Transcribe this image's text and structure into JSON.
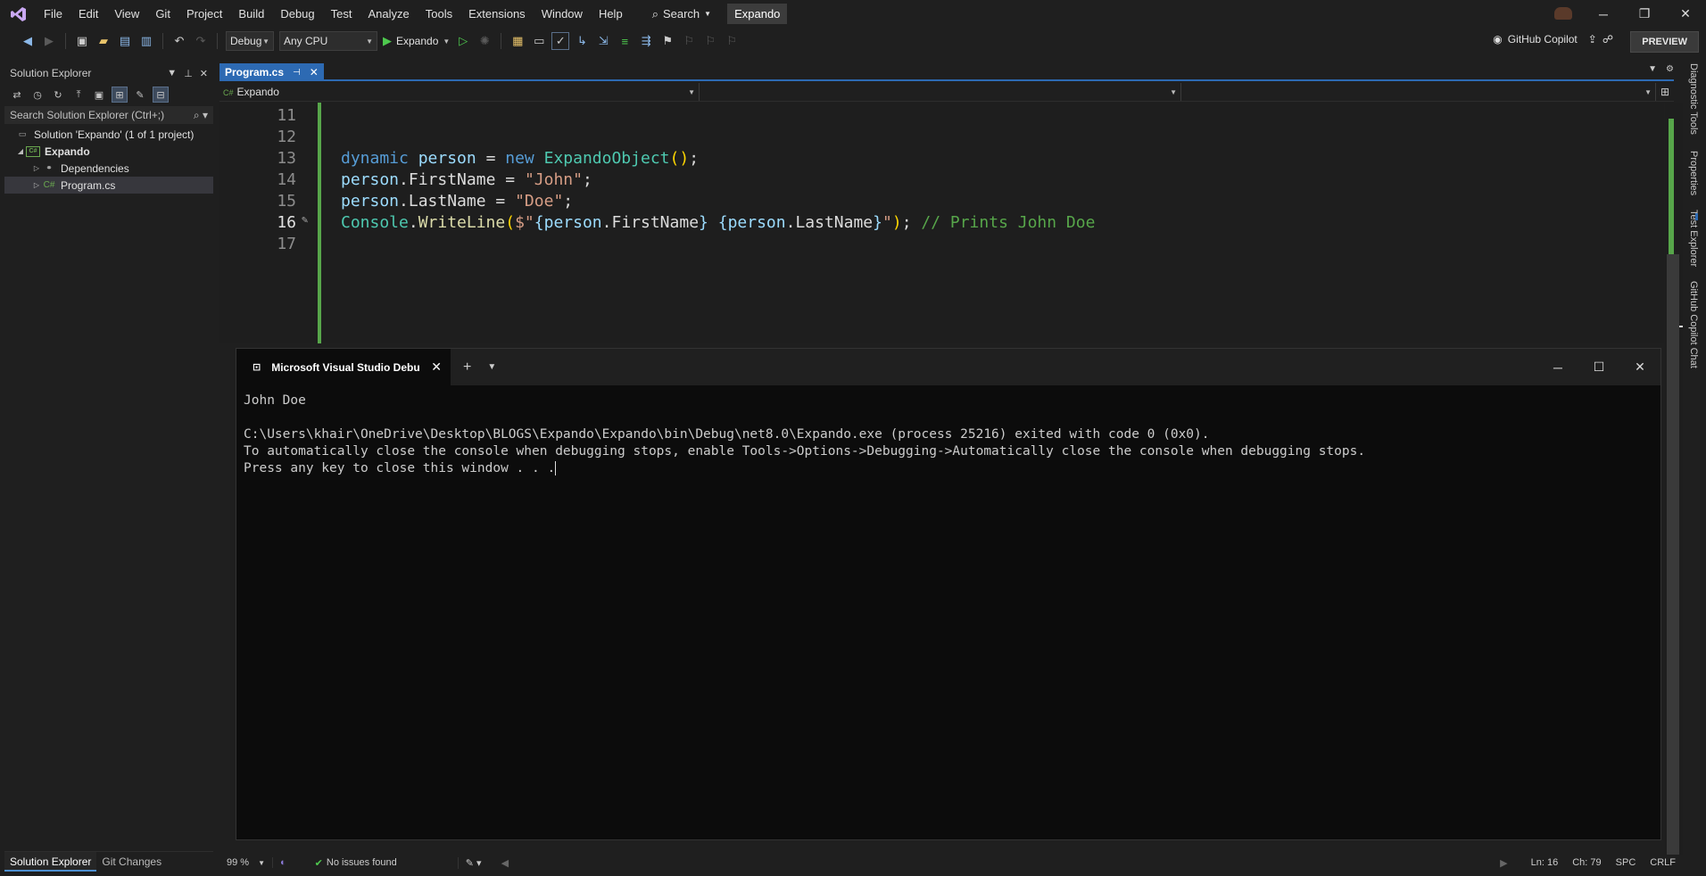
{
  "menubar": {
    "items": [
      "File",
      "Edit",
      "View",
      "Git",
      "Project",
      "Build",
      "Debug",
      "Test",
      "Analyze",
      "Tools",
      "Extensions",
      "Window",
      "Help"
    ],
    "search_label": "Search",
    "solution_badge": "Expando"
  },
  "toolbar": {
    "config": "Debug",
    "platform": "Any CPU",
    "run_target": "Expando",
    "copilot_label": "GitHub Copilot",
    "preview_label": "PREVIEW"
  },
  "solution_explorer": {
    "title": "Solution Explorer",
    "search_placeholder": "Search Solution Explorer (Ctrl+;)",
    "tree": {
      "solution": "Solution 'Expando' (1 of 1 project)",
      "project": "Expando",
      "dependencies": "Dependencies",
      "file": "Program.cs",
      "file_prefix": "C#"
    },
    "bottom_tabs": [
      "Solution Explorer",
      "Git Changes"
    ]
  },
  "editor": {
    "tab_label": "Program.cs",
    "nav_project": "Expando",
    "line_numbers": [
      "11",
      "12",
      "13",
      "14",
      "15",
      "16",
      "17"
    ],
    "current_line": "16",
    "lines": {
      "l13": {
        "kw": "dynamic",
        "var": "person",
        "op": " = ",
        "new": "new",
        "type": "ExpandoObject",
        "p1": "(",
        "p2": ")",
        "end": ";"
      },
      "l14": {
        "obj": "person",
        "dot": ".",
        "prop": "FirstName",
        "op": " = ",
        "str": "\"John\"",
        "end": ";"
      },
      "l15": {
        "obj": "person",
        "dot": ".",
        "prop": "LastName",
        "op": " = ",
        "str": "\"Doe\"",
        "end": ";"
      },
      "l16": {
        "cls": "Console",
        "dot": ".",
        "fn": "WriteLine",
        "p1": "(",
        "str_open": "$\"",
        "b1": "{",
        "a": "person",
        "dot2": ".",
        "ap": "FirstName",
        "b2": "}",
        "sp": " ",
        "b3": "{",
        "b": "person",
        "dot3": ".",
        "bp": "LastName",
        "b4": "}",
        "str_close": "\"",
        "p2": ")",
        "end": ";",
        "comment": "// Prints John Doe"
      }
    }
  },
  "console": {
    "tab_title": "Microsoft Visual Studio Debu",
    "output": [
      "John Doe",
      "",
      "C:\\Users\\khair\\OneDrive\\Desktop\\BLOGS\\Expando\\Expando\\bin\\Debug\\net8.0\\Expando.exe (process 25216) exited with code 0 (0x0).",
      "To automatically close the console when debugging stops, enable Tools->Options->Debugging->Automatically close the console when debugging stops.",
      "Press any key to close this window . . ."
    ]
  },
  "right_tabs": [
    "Diagnostic Tools",
    "Properties",
    "Test Explorer",
    "GitHub Copilot Chat"
  ],
  "statusbar": {
    "zoom": "99 %",
    "issues": "No issues found",
    "line": "Ln: 16",
    "col": "Ch: 79",
    "spc": "SPC",
    "eol": "CRLF"
  },
  "colors": {
    "accent": "#2d6ab3",
    "added_line": "#57a64a",
    "keyword": "#569cd6",
    "type": "#4ec9b0",
    "string": "#d69d85",
    "comment": "#57a64a"
  }
}
